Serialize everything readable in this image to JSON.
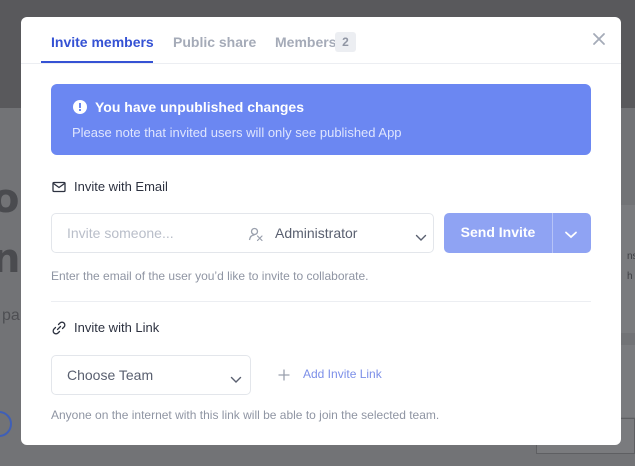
{
  "background": {
    "text_a": "or",
    "text_b": "nu",
    "text_small": "pa",
    "right_text_1": "ns",
    "right_text_2": "h"
  },
  "tabs": [
    {
      "label": "Invite members",
      "active": true
    },
    {
      "label": "Public share",
      "active": false
    },
    {
      "label": "Members",
      "active": false,
      "badge": "2"
    }
  ],
  "alert": {
    "title": "You have unpublished changes",
    "description": "Please note that invited users will only see published App",
    "color": "#6b87f2"
  },
  "invite_email": {
    "title": "Invite with Email",
    "placeholder": "Invite someone...",
    "role": "Administrator",
    "send_label": "Send Invite",
    "helper": "Enter the email of the user you’d like to invite to collaborate."
  },
  "invite_link": {
    "title": "Invite with Link",
    "team_placeholder": "Choose Team",
    "add_link_label": "Add Invite Link",
    "helper": "Anyone on the internet with this link will be able to join the selected team."
  },
  "colors": {
    "accent": "#3552d4",
    "send_button": "#8fa3f3"
  }
}
